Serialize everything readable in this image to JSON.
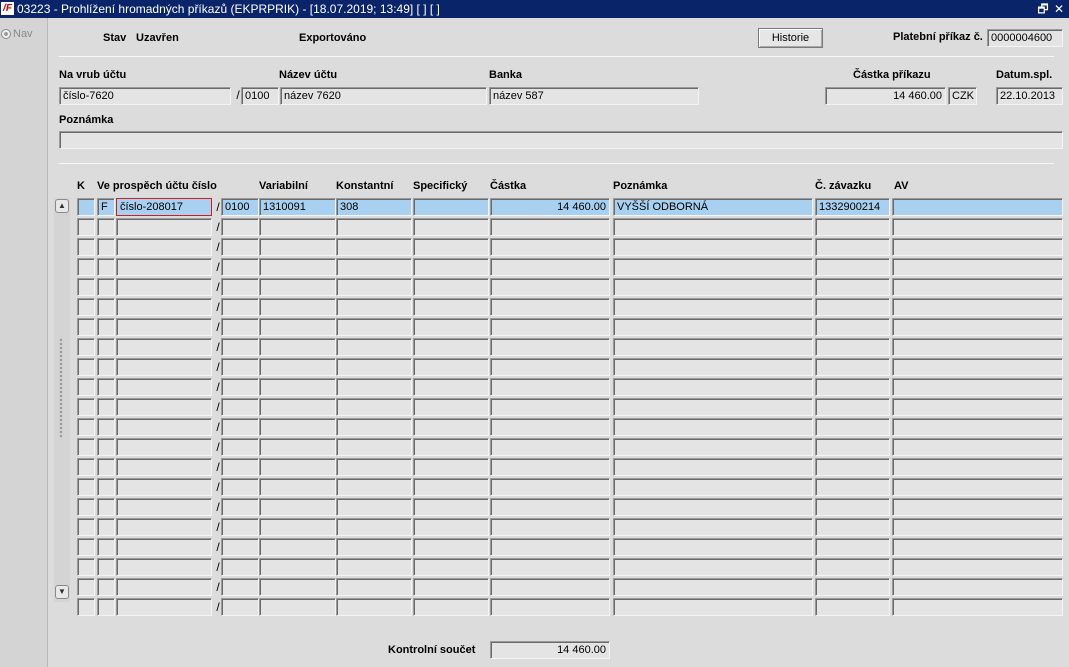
{
  "window": {
    "icon_label": "/F",
    "title": "03223 - Prohlížení hromadných příkazů (EKPRPRIK) - [18.07.2019; 13:49]  [ ]  [ ]",
    "restore_glyph": "🗗",
    "close_glyph": "✕"
  },
  "nav": {
    "label": "Nav"
  },
  "header": {
    "stav_label": "Stav",
    "stav_value": "Uzavřen",
    "export_status": "Exportováno",
    "historie_button": "Historie",
    "platebni_prikaz_label": "Platební příkaz č.",
    "platebni_prikaz_value": "0000004600"
  },
  "debit": {
    "na_vrub_label": "Na vrub účtu",
    "ucet_value": "číslo-7620",
    "slash": "/",
    "bank_code": "0100",
    "nazev_label": "Název účtu",
    "nazev_value": "název 7620",
    "banka_label": "Banka",
    "banka_value": "název 587",
    "castka_label": "Částka příkazu",
    "castka_value": "14 460.00",
    "mena_value": "CZK",
    "datum_label": "Datum.spl.",
    "datum_value": "22.10.2013",
    "poznamka_label": "Poznámka",
    "poznamka_value": ""
  },
  "grid": {
    "headers": {
      "k": "K",
      "ucet": "Ve prospěch účtu číslo",
      "variabilni": "Variabilní",
      "konstantni": "Konstantní",
      "specificky": "Specifický",
      "castka": "Částka",
      "poznamka": "Poznámka",
      "zavazek": "Č. závazku",
      "av": "AV"
    },
    "rows": [
      {
        "k": "",
        "f": "F",
        "ucet": "číslo-208017",
        "slash": "/",
        "bank": "0100",
        "variabilni": "1310091",
        "konstantni": "308",
        "specificky": "",
        "castka": "14 460.00",
        "poznamka": "VYŠŠÍ ODBORNÁ",
        "zavazek": "1332900214",
        "av": ""
      },
      {
        "k": "",
        "f": "",
        "ucet": "",
        "slash": "/",
        "bank": "",
        "variabilni": "",
        "konstantni": "",
        "specificky": "",
        "castka": "",
        "poznamka": "",
        "zavazek": "",
        "av": ""
      },
      {
        "k": "",
        "f": "",
        "ucet": "",
        "slash": "/",
        "bank": "",
        "variabilni": "",
        "konstantni": "",
        "specificky": "",
        "castka": "",
        "poznamka": "",
        "zavazek": "",
        "av": ""
      },
      {
        "k": "",
        "f": "",
        "ucet": "",
        "slash": "/",
        "bank": "",
        "variabilni": "",
        "konstantni": "",
        "specificky": "",
        "castka": "",
        "poznamka": "",
        "zavazek": "",
        "av": ""
      },
      {
        "k": "",
        "f": "",
        "ucet": "",
        "slash": "/",
        "bank": "",
        "variabilni": "",
        "konstantni": "",
        "specificky": "",
        "castka": "",
        "poznamka": "",
        "zavazek": "",
        "av": ""
      },
      {
        "k": "",
        "f": "",
        "ucet": "",
        "slash": "/",
        "bank": "",
        "variabilni": "",
        "konstantni": "",
        "specificky": "",
        "castka": "",
        "poznamka": "",
        "zavazek": "",
        "av": ""
      },
      {
        "k": "",
        "f": "",
        "ucet": "",
        "slash": "/",
        "bank": "",
        "variabilni": "",
        "konstantni": "",
        "specificky": "",
        "castka": "",
        "poznamka": "",
        "zavazek": "",
        "av": ""
      },
      {
        "k": "",
        "f": "",
        "ucet": "",
        "slash": "/",
        "bank": "",
        "variabilni": "",
        "konstantni": "",
        "specificky": "",
        "castka": "",
        "poznamka": "",
        "zavazek": "",
        "av": ""
      },
      {
        "k": "",
        "f": "",
        "ucet": "",
        "slash": "/",
        "bank": "",
        "variabilni": "",
        "konstantni": "",
        "specificky": "",
        "castka": "",
        "poznamka": "",
        "zavazek": "",
        "av": ""
      },
      {
        "k": "",
        "f": "",
        "ucet": "",
        "slash": "/",
        "bank": "",
        "variabilni": "",
        "konstantni": "",
        "specificky": "",
        "castka": "",
        "poznamka": "",
        "zavazek": "",
        "av": ""
      },
      {
        "k": "",
        "f": "",
        "ucet": "",
        "slash": "/",
        "bank": "",
        "variabilni": "",
        "konstantni": "",
        "specificky": "",
        "castka": "",
        "poznamka": "",
        "zavazek": "",
        "av": ""
      },
      {
        "k": "",
        "f": "",
        "ucet": "",
        "slash": "/",
        "bank": "",
        "variabilni": "",
        "konstantni": "",
        "specificky": "",
        "castka": "",
        "poznamka": "",
        "zavazek": "",
        "av": ""
      },
      {
        "k": "",
        "f": "",
        "ucet": "",
        "slash": "/",
        "bank": "",
        "variabilni": "",
        "konstantni": "",
        "specificky": "",
        "castka": "",
        "poznamka": "",
        "zavazek": "",
        "av": ""
      },
      {
        "k": "",
        "f": "",
        "ucet": "",
        "slash": "/",
        "bank": "",
        "variabilni": "",
        "konstantni": "",
        "specificky": "",
        "castka": "",
        "poznamka": "",
        "zavazek": "",
        "av": ""
      },
      {
        "k": "",
        "f": "",
        "ucet": "",
        "slash": "/",
        "bank": "",
        "variabilni": "",
        "konstantni": "",
        "specificky": "",
        "castka": "",
        "poznamka": "",
        "zavazek": "",
        "av": ""
      },
      {
        "k": "",
        "f": "",
        "ucet": "",
        "slash": "/",
        "bank": "",
        "variabilni": "",
        "konstantni": "",
        "specificky": "",
        "castka": "",
        "poznamka": "",
        "zavazek": "",
        "av": ""
      },
      {
        "k": "",
        "f": "",
        "ucet": "",
        "slash": "/",
        "bank": "",
        "variabilni": "",
        "konstantni": "",
        "specificky": "",
        "castka": "",
        "poznamka": "",
        "zavazek": "",
        "av": ""
      },
      {
        "k": "",
        "f": "",
        "ucet": "",
        "slash": "/",
        "bank": "",
        "variabilni": "",
        "konstantni": "",
        "specificky": "",
        "castka": "",
        "poznamka": "",
        "zavazek": "",
        "av": ""
      },
      {
        "k": "",
        "f": "",
        "ucet": "",
        "slash": "/",
        "bank": "",
        "variabilni": "",
        "konstantni": "",
        "specificky": "",
        "castka": "",
        "poznamka": "",
        "zavazek": "",
        "av": ""
      },
      {
        "k": "",
        "f": "",
        "ucet": "",
        "slash": "/",
        "bank": "",
        "variabilni": "",
        "konstantni": "",
        "specificky": "",
        "castka": "",
        "poznamka": "",
        "zavazek": "",
        "av": ""
      },
      {
        "k": "",
        "f": "",
        "ucet": "",
        "slash": "/",
        "bank": "",
        "variabilni": "",
        "konstantni": "",
        "specificky": "",
        "castka": "",
        "poznamka": "",
        "zavazek": "",
        "av": ""
      }
    ],
    "scroll_up_glyph": "▲",
    "scroll_down_glyph": "▼"
  },
  "footer": {
    "kontrolni_label": "Kontrolní součet",
    "kontrolni_value": "14 460.00"
  },
  "colors": {
    "titlebar": "#0a246a",
    "selected_row": "#a8d0f0",
    "focus_border": "#cc2020",
    "form_background": "#dcdcdc"
  }
}
